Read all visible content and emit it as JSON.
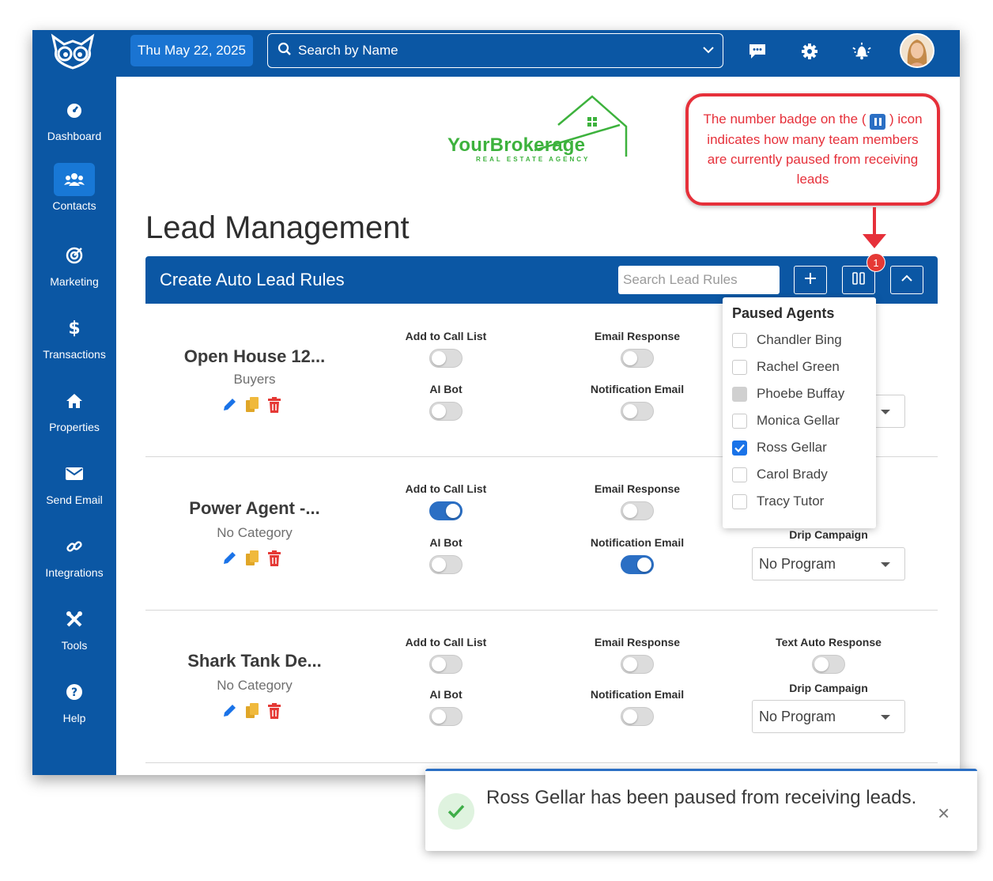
{
  "header": {
    "date": "Thu May 22, 2025",
    "search_placeholder": "Search by Name"
  },
  "sidebar": {
    "items": [
      {
        "label": "Dashboard",
        "icon": "dashboard-icon"
      },
      {
        "label": "Contacts",
        "icon": "users-icon",
        "active": true
      },
      {
        "label": "Marketing",
        "icon": "bullseye-icon"
      },
      {
        "label": "Transactions",
        "icon": "dollar-icon"
      },
      {
        "label": "Properties",
        "icon": "home-icon"
      },
      {
        "label": "Send Email",
        "icon": "envelope-icon"
      },
      {
        "label": "Integrations",
        "icon": "link-icon"
      },
      {
        "label": "Tools",
        "icon": "tools-icon"
      },
      {
        "label": "Help",
        "icon": "question-icon"
      }
    ]
  },
  "brand": {
    "name": "YourBrokerage",
    "tagline": "REAL ESTATE AGENCY",
    "color": "#3db23d"
  },
  "page": {
    "title": "Lead Management"
  },
  "panel": {
    "title": "Create Auto Lead Rules",
    "search_placeholder": "Search Lead Rules",
    "paused_count": "1"
  },
  "columns": {
    "add_to_call_list": "Add to Call List",
    "ai_bot": "AI Bot",
    "email_response": "Email Response",
    "notification_email": "Notification Email",
    "text_auto_response": "Text Auto Response",
    "drip_campaign": "Drip Campaign"
  },
  "rules": [
    {
      "name": "Open House 12...",
      "category": "Buyers",
      "add_to_call_list": false,
      "ai_bot": false,
      "email_response": false,
      "notification_email": false,
      "drip": ""
    },
    {
      "name": "Power Agent -...",
      "category": "No Category",
      "add_to_call_list": true,
      "ai_bot": false,
      "email_response": false,
      "notification_email": true,
      "drip": "No Program"
    },
    {
      "name": "Shark Tank De...",
      "category": "No Category",
      "add_to_call_list": false,
      "ai_bot": false,
      "email_response": false,
      "notification_email": false,
      "text_auto_response": false,
      "drip": "No Program"
    }
  ],
  "paused_agents": {
    "title": "Paused Agents",
    "agents": [
      {
        "name": "Chandler Bing",
        "state": "unchecked"
      },
      {
        "name": "Rachel Green",
        "state": "unchecked"
      },
      {
        "name": "Phoebe Buffay",
        "state": "disabled"
      },
      {
        "name": "Monica Gellar",
        "state": "unchecked"
      },
      {
        "name": "Ross Gellar",
        "state": "checked"
      },
      {
        "name": "Carol Brady",
        "state": "unchecked"
      },
      {
        "name": "Tracy Tutor",
        "state": "unchecked"
      }
    ]
  },
  "callout": {
    "text_before": "The number badge on the (",
    "text_after": ") icon indicates how many team members are currently paused from receiving leads",
    "color": "#e6303a"
  },
  "toast": {
    "message": "Ross Gellar has been paused from receiving leads.",
    "close": "×"
  },
  "colors": {
    "primary": "#0b57a4",
    "accent": "#1a74d2",
    "toggle_on": "#2b6fc4"
  }
}
